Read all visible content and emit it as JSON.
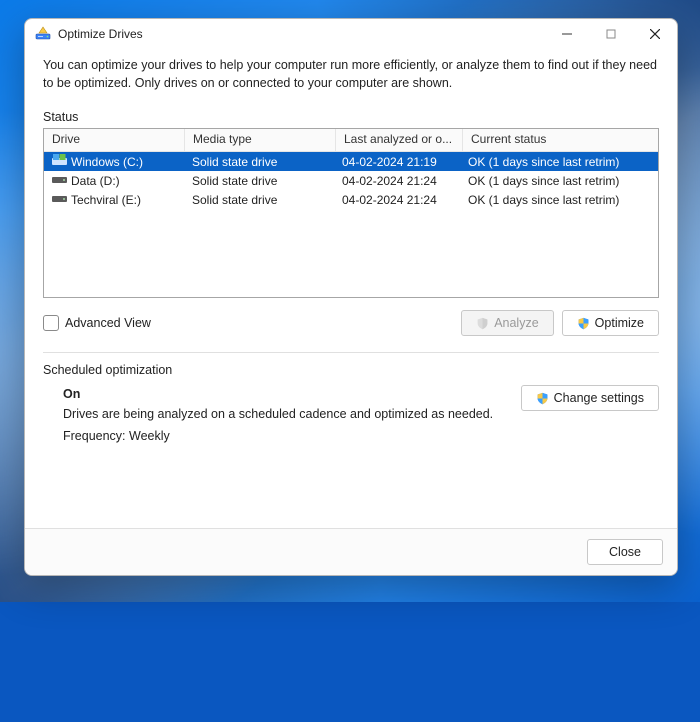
{
  "window": {
    "title": "Optimize Drives"
  },
  "intro": "You can optimize your drives to help your computer run more efficiently, or analyze them to find out if they need to be optimized. Only drives on or connected to your computer are shown.",
  "status_label": "Status",
  "columns": {
    "drive": "Drive",
    "media": "Media type",
    "last": "Last analyzed or o...",
    "status": "Current status"
  },
  "drives": [
    {
      "name": "Windows (C:)",
      "media": "Solid state drive",
      "last": "04-02-2024 21:19",
      "status": "OK (1 days since last retrim)",
      "icon": "os"
    },
    {
      "name": "Data (D:)",
      "media": "Solid state drive",
      "last": "04-02-2024 21:24",
      "status": "OK (1 days since last retrim)",
      "icon": "hdd"
    },
    {
      "name": "Techviral (E:)",
      "media": "Solid state drive",
      "last": "04-02-2024 21:24",
      "status": "OK (1 days since last retrim)",
      "icon": "hdd"
    }
  ],
  "advanced_view_label": "Advanced View",
  "buttons": {
    "analyze": "Analyze",
    "optimize": "Optimize",
    "change_settings": "Change settings",
    "close": "Close"
  },
  "schedule": {
    "heading": "Scheduled optimization",
    "state": "On",
    "desc": "Drives are being analyzed on a scheduled cadence and optimized as needed.",
    "frequency_label": "Frequency:",
    "frequency_value": "Weekly"
  }
}
